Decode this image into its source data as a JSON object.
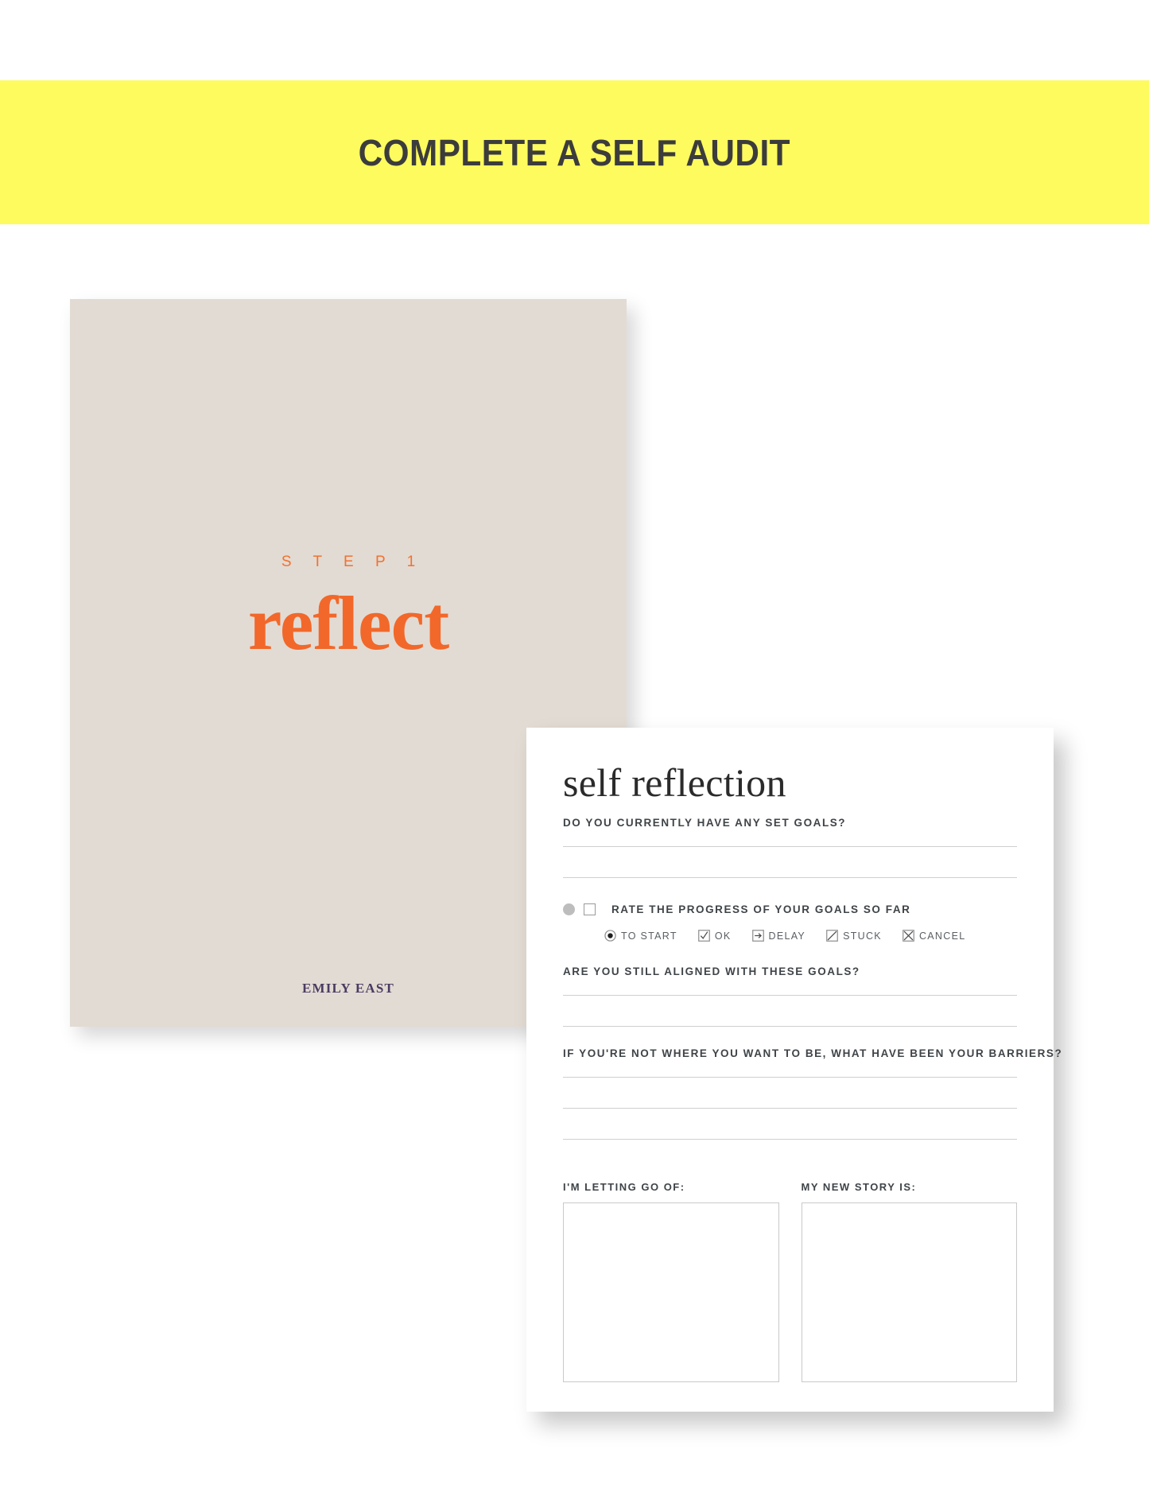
{
  "banner": {
    "title": "COMPLETE A SELF AUDIT",
    "background_color": "#FDFB5E",
    "text_color": "#3C3C3C"
  },
  "cover_page": {
    "step_label": "S T E P   1",
    "word": "reflect",
    "brand": "EMILY EAST",
    "background_color": "#E2DBD3",
    "accent_color": "#F2682A",
    "brand_color": "#4A3B62"
  },
  "form": {
    "title": "self reflection",
    "questions": {
      "q1": "DO YOU CURRENTLY HAVE ANY SET GOALS?",
      "rating": "RATE THE PROGRESS OF YOUR GOALS SO FAR",
      "q2": "ARE YOU STILL ALIGNED WITH THESE GOALS?",
      "q3": "IF YOU'RE NOT WHERE YOU WANT TO BE, WHAT HAVE BEEN YOUR BARRIERS?"
    },
    "legend": [
      {
        "icon": "radio-filled-icon",
        "label": "TO START"
      },
      {
        "icon": "checkbox-check-icon",
        "label": "OK"
      },
      {
        "icon": "arrow-right-box-icon",
        "label": "DELAY"
      },
      {
        "icon": "diagonal-slash-box-icon",
        "label": "STUCK"
      },
      {
        "icon": "x-box-icon",
        "label": "CANCEL"
      }
    ],
    "columns": [
      {
        "heading": "I'M LETTING GO OF:",
        "value": ""
      },
      {
        "heading": "MY NEW STORY IS:",
        "value": ""
      }
    ],
    "rule_color": "#CFCFCF",
    "card_background": "#FFFFFF"
  }
}
